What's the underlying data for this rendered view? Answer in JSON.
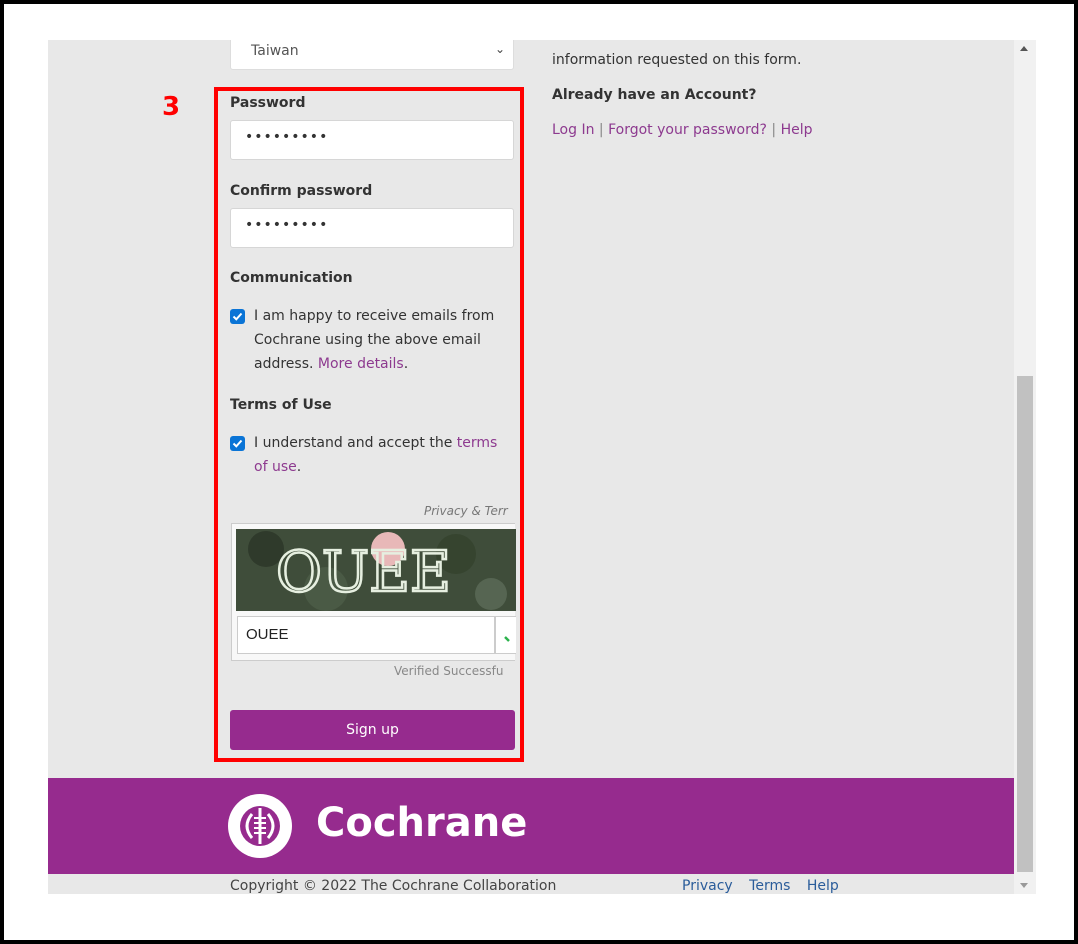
{
  "country": {
    "value": "Taiwan"
  },
  "password": {
    "label": "Password",
    "value": "•••••••••"
  },
  "confirm_password": {
    "label": "Confirm password",
    "value": "•••••••••"
  },
  "communication": {
    "heading": "Communication",
    "text": "I am happy to receive emails from Cochrane using the above email address. ",
    "link": "More details",
    "suffix": ".",
    "checked": true
  },
  "terms": {
    "heading": "Terms of Use",
    "text": "I understand and accept the ",
    "link": "terms of use",
    "suffix": ".",
    "checked": true
  },
  "captcha": {
    "privacy_label": "Privacy & Terr",
    "image_text": "OUEE",
    "input_value": "OUEE",
    "verified_text": "Verified Successfu"
  },
  "signup_label": "Sign up",
  "side": {
    "note": "information requested on this form.",
    "heading": "Already have an Account?",
    "login": "Log In",
    "forgot": "Forgot your password?",
    "help": "Help",
    "sep": " | "
  },
  "footer": {
    "brand": "Cochrane",
    "copyright": "Copyright © 2022 The Cochrane Collaboration",
    "links": [
      "Privacy",
      "Terms",
      "Help"
    ]
  },
  "annotation": {
    "step": "3"
  },
  "colors": {
    "brand": "#962b8e",
    "link": "#8d3a8f",
    "highlight": "#ff0000",
    "checkbox": "#0a74d6"
  }
}
